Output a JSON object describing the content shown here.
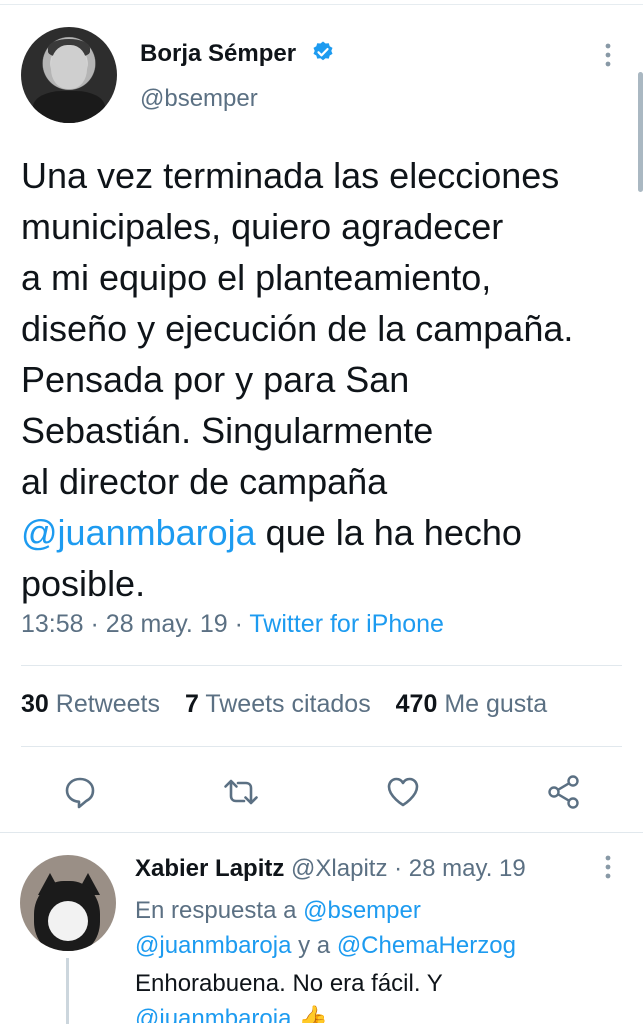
{
  "tweet": {
    "author_name": "Borja Sémper",
    "author_handle": "@bsemper",
    "verified": true,
    "text_lines": [
      "Una vez terminada las elecciones",
      "municipales, quiero agradecer",
      "a mi equipo el planteamiento,",
      "diseño y ejecución de la campaña.",
      "Pensada por y para San",
      "Sebastián. Singularmente",
      "al director de campaña"
    ],
    "mention": "@juanmbaroja",
    "text_after_mention": " que la ha hecho",
    "text_last_line": "posible.",
    "time": "13:58",
    "date": "28 may. 19",
    "separator": "·",
    "source": "Twitter for iPhone",
    "stats": {
      "retweets_count": "30",
      "retweets_label": "Retweets",
      "quotes_count": "7",
      "quotes_label": "Tweets citados",
      "likes_count": "470",
      "likes_label": "Me gusta"
    }
  },
  "actions": {
    "reply": "reply-icon",
    "retweet": "retweet-icon",
    "like": "heart-icon",
    "share": "share-icon"
  },
  "reply": {
    "author_name": "Xabier Lapitz",
    "author_handle": "@Xlapitz",
    "separator": "·",
    "date": "28 may. 19",
    "in_reply_prefix": "En respuesta a ",
    "in_reply_user1": "@bsemper",
    "in_reply_user2": "@juanmbaroja",
    "in_reply_and": " y a ",
    "in_reply_user3": "@ChemaHerzog",
    "text_line1": "Enhorabuena. No era fácil. Y",
    "text_line2_partial": "@juanmbaroja 👍"
  },
  "colors": {
    "accent": "#1d9bf0",
    "secondary_text": "#5b7083",
    "primary_text": "#0f1419",
    "divider": "#e1e8ed"
  }
}
